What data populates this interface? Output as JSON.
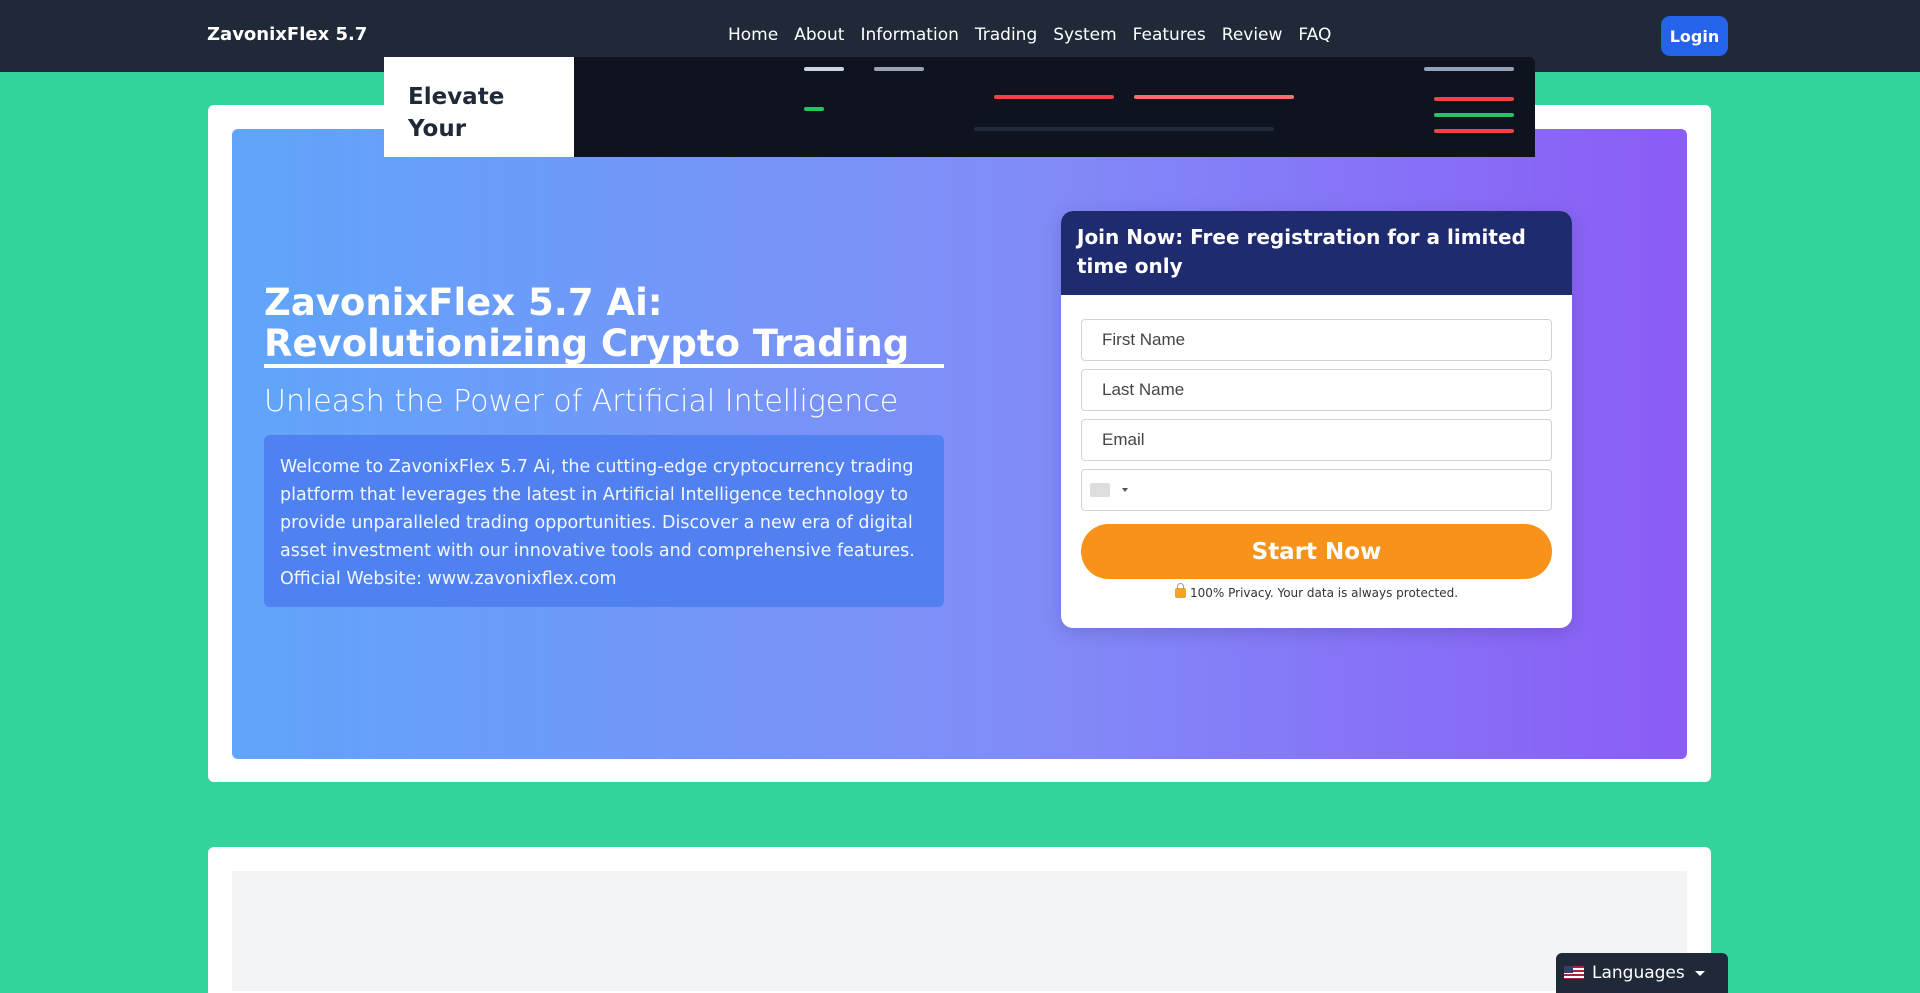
{
  "header": {
    "brand": "ZavonixFlex 5.7",
    "nav": [
      "Home",
      "About",
      "Information",
      "Trading",
      "System",
      "Features",
      "Review",
      "FAQ"
    ],
    "login_label": "Login"
  },
  "hero": {
    "title": "ZavonixFlex 5.7 Ai: Revolutionizing Crypto Trading",
    "subtitle": "Unleash the Power of Artificial Intelligence",
    "description": "Welcome to ZavonixFlex 5.7 Ai, the cutting-edge cryptocurrency trading platform that leverages the latest in Artificial Intelligence technology to provide unparalleled trading opportunities. Discover a new era of digital asset investment with our innovative tools and comprehensive features. Official Website: www.zavonixflex.com"
  },
  "form": {
    "heading": "Join Now: Free registration for a limited time only",
    "first_name_placeholder": "First Name",
    "last_name_placeholder": "Last Name",
    "email_placeholder": "Email",
    "submit_label": "Start Now",
    "privacy_text": "100% Privacy. Your data is always protected."
  },
  "second_section": {
    "title": "Elevate Your"
  },
  "language": {
    "label": "Languages"
  }
}
